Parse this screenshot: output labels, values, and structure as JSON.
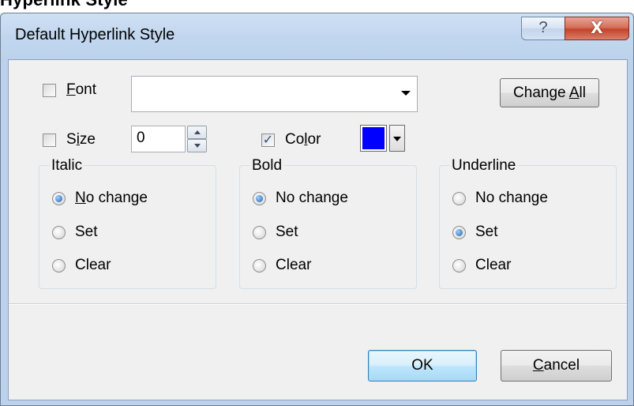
{
  "page_heading": "Hyperlink Style",
  "dialog": {
    "title": "Default Hyperlink Style",
    "help_glyph": "?",
    "close_glyph": "X"
  },
  "font": {
    "label_pre": "",
    "label_accel": "F",
    "label_post": "ont",
    "checked": false,
    "value": ""
  },
  "size": {
    "label_pre": "S",
    "label_accel": "i",
    "label_post": "ze",
    "checked": false,
    "value": "0"
  },
  "color": {
    "label_pre": "Co",
    "label_accel": "l",
    "label_post": "or",
    "checked": true,
    "swatch": "#0000ff"
  },
  "change_all": {
    "pre": "Change ",
    "accel": "A",
    "post": "ll"
  },
  "groups": [
    {
      "title": "Italic",
      "options": [
        {
          "pre": "",
          "accel": "N",
          "post": "o change",
          "selected": true
        },
        {
          "pre": "Set",
          "accel": "",
          "post": "",
          "selected": false
        },
        {
          "pre": "Clear",
          "accel": "",
          "post": "",
          "selected": false
        }
      ]
    },
    {
      "title": "Bold",
      "options": [
        {
          "pre": "No change",
          "accel": "",
          "post": "",
          "selected": true
        },
        {
          "pre": "Set",
          "accel": "",
          "post": "",
          "selected": false
        },
        {
          "pre": "Clear",
          "accel": "",
          "post": "",
          "selected": false
        }
      ]
    },
    {
      "title": "Underline",
      "options": [
        {
          "pre": "No chan",
          "accel": "g",
          "post": "e",
          "selected": false
        },
        {
          "pre": "Set",
          "accel": "",
          "post": "",
          "selected": true
        },
        {
          "pre": "Clear",
          "accel": "",
          "post": "",
          "selected": false
        }
      ]
    }
  ],
  "ok_label": "OK",
  "cancel": {
    "pre": "",
    "accel": "C",
    "post": "ancel"
  },
  "colors": {
    "checkmark": "#2b4e84",
    "radio_selected": "#1f5ea8",
    "default_button_border": "#3c7fb1"
  }
}
